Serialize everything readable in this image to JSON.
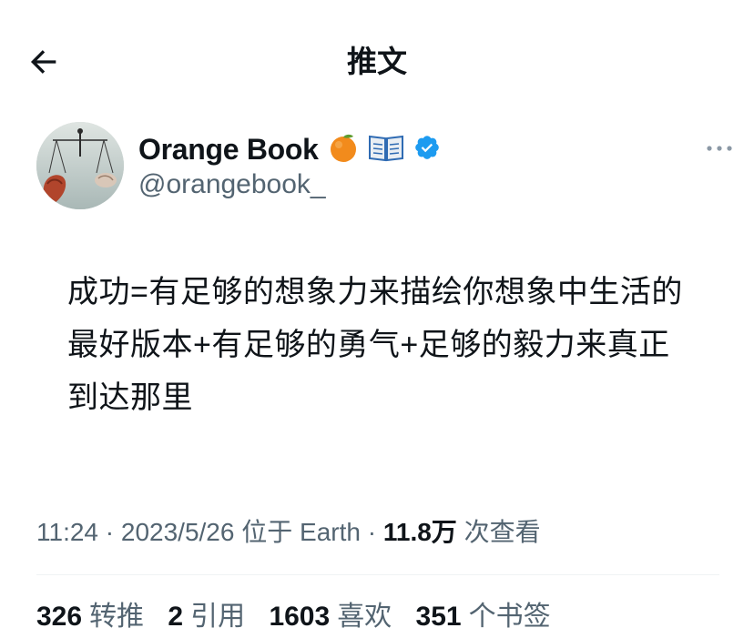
{
  "header": {
    "title": "推文",
    "back_icon": "arrow-left-icon"
  },
  "author": {
    "display_name": "Orange Book",
    "emojis": [
      "orange-emoji",
      "open-book-emoji"
    ],
    "verified_icon": "verified-badge-icon",
    "verified_color": "#1d9bf0",
    "handle": "@orangebook_",
    "more_icon": "more-horizontal-icon"
  },
  "tweet": {
    "lines": [
      "成功=有足够的想象力来描绘你想象中生活的",
      "最好版本+有足够的勇气+足够的毅力来真正",
      "到达那里"
    ]
  },
  "meta": {
    "time": "11:24",
    "sep1": " · ",
    "date": "2023/5/26",
    "location": " 位于 Earth",
    "sep2": " · ",
    "views_count": "11.8万",
    "views_label": " 次查看"
  },
  "stats": [
    {
      "count": "326",
      "label": "转推"
    },
    {
      "count": "2",
      "label": "引用"
    },
    {
      "count": "1603",
      "label": "喜欢"
    },
    {
      "count": "351",
      "label": "个书签"
    }
  ]
}
